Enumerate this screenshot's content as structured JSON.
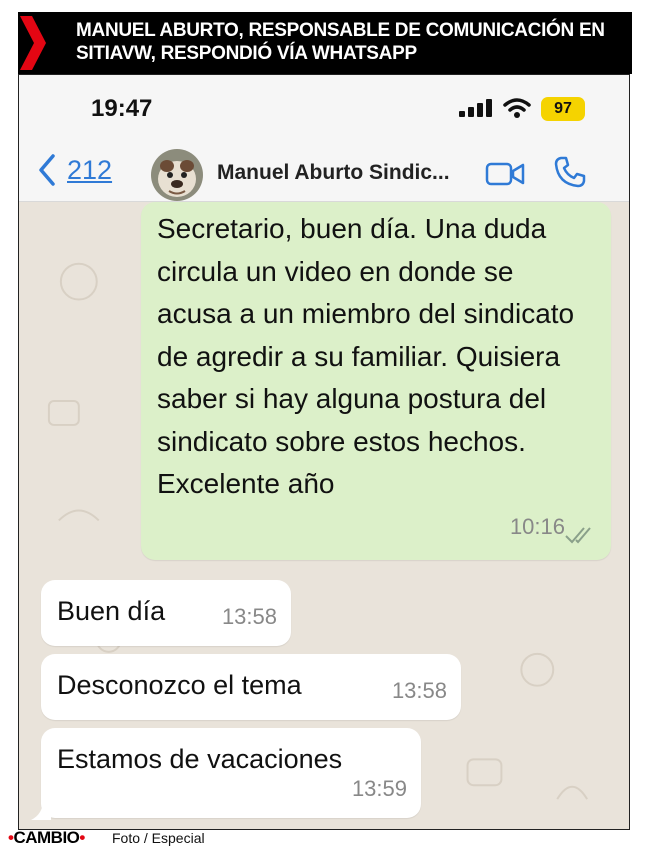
{
  "headline": "MANUEL ABURTO, RESPONSABLE DE COMUNICACIÓN EN SITIAVW, RESPONDIÓ VÍA WHATSAPP",
  "status_bar": {
    "time": "19:47",
    "battery": "97",
    "signal_icon": "signal-bars-icon",
    "wifi_icon": "wifi-icon"
  },
  "chat_header": {
    "back_count": "212",
    "contact_name": "Manuel Aburto Sindic...",
    "video_icon": "video-camera-icon",
    "call_icon": "phone-icon"
  },
  "messages": [
    {
      "direction": "outgoing",
      "text": "Secretario, buen día. Una duda circula un video en donde se acusa a un miembro del sindicato de agredir a su familiar. Quisiera saber si hay alguna postura del sindicato sobre estos hechos. Excelente año",
      "time": "10:16",
      "read": true
    },
    {
      "direction": "incoming",
      "text": "Buen día",
      "time": "13:58"
    },
    {
      "direction": "incoming",
      "text": "Desconozco el tema",
      "time": "13:58"
    },
    {
      "direction": "incoming",
      "text": "Estamos de vacaciones",
      "time": "13:59"
    }
  ],
  "footer": {
    "logo": "CAMBIO",
    "credit": "Foto / Especial"
  },
  "colors": {
    "accent_red": "#e30613",
    "ios_blue": "#2f7ad6",
    "outgoing_bubble": "#dcf0c9",
    "incoming_bubble": "#ffffff",
    "battery": "#f5d300"
  }
}
